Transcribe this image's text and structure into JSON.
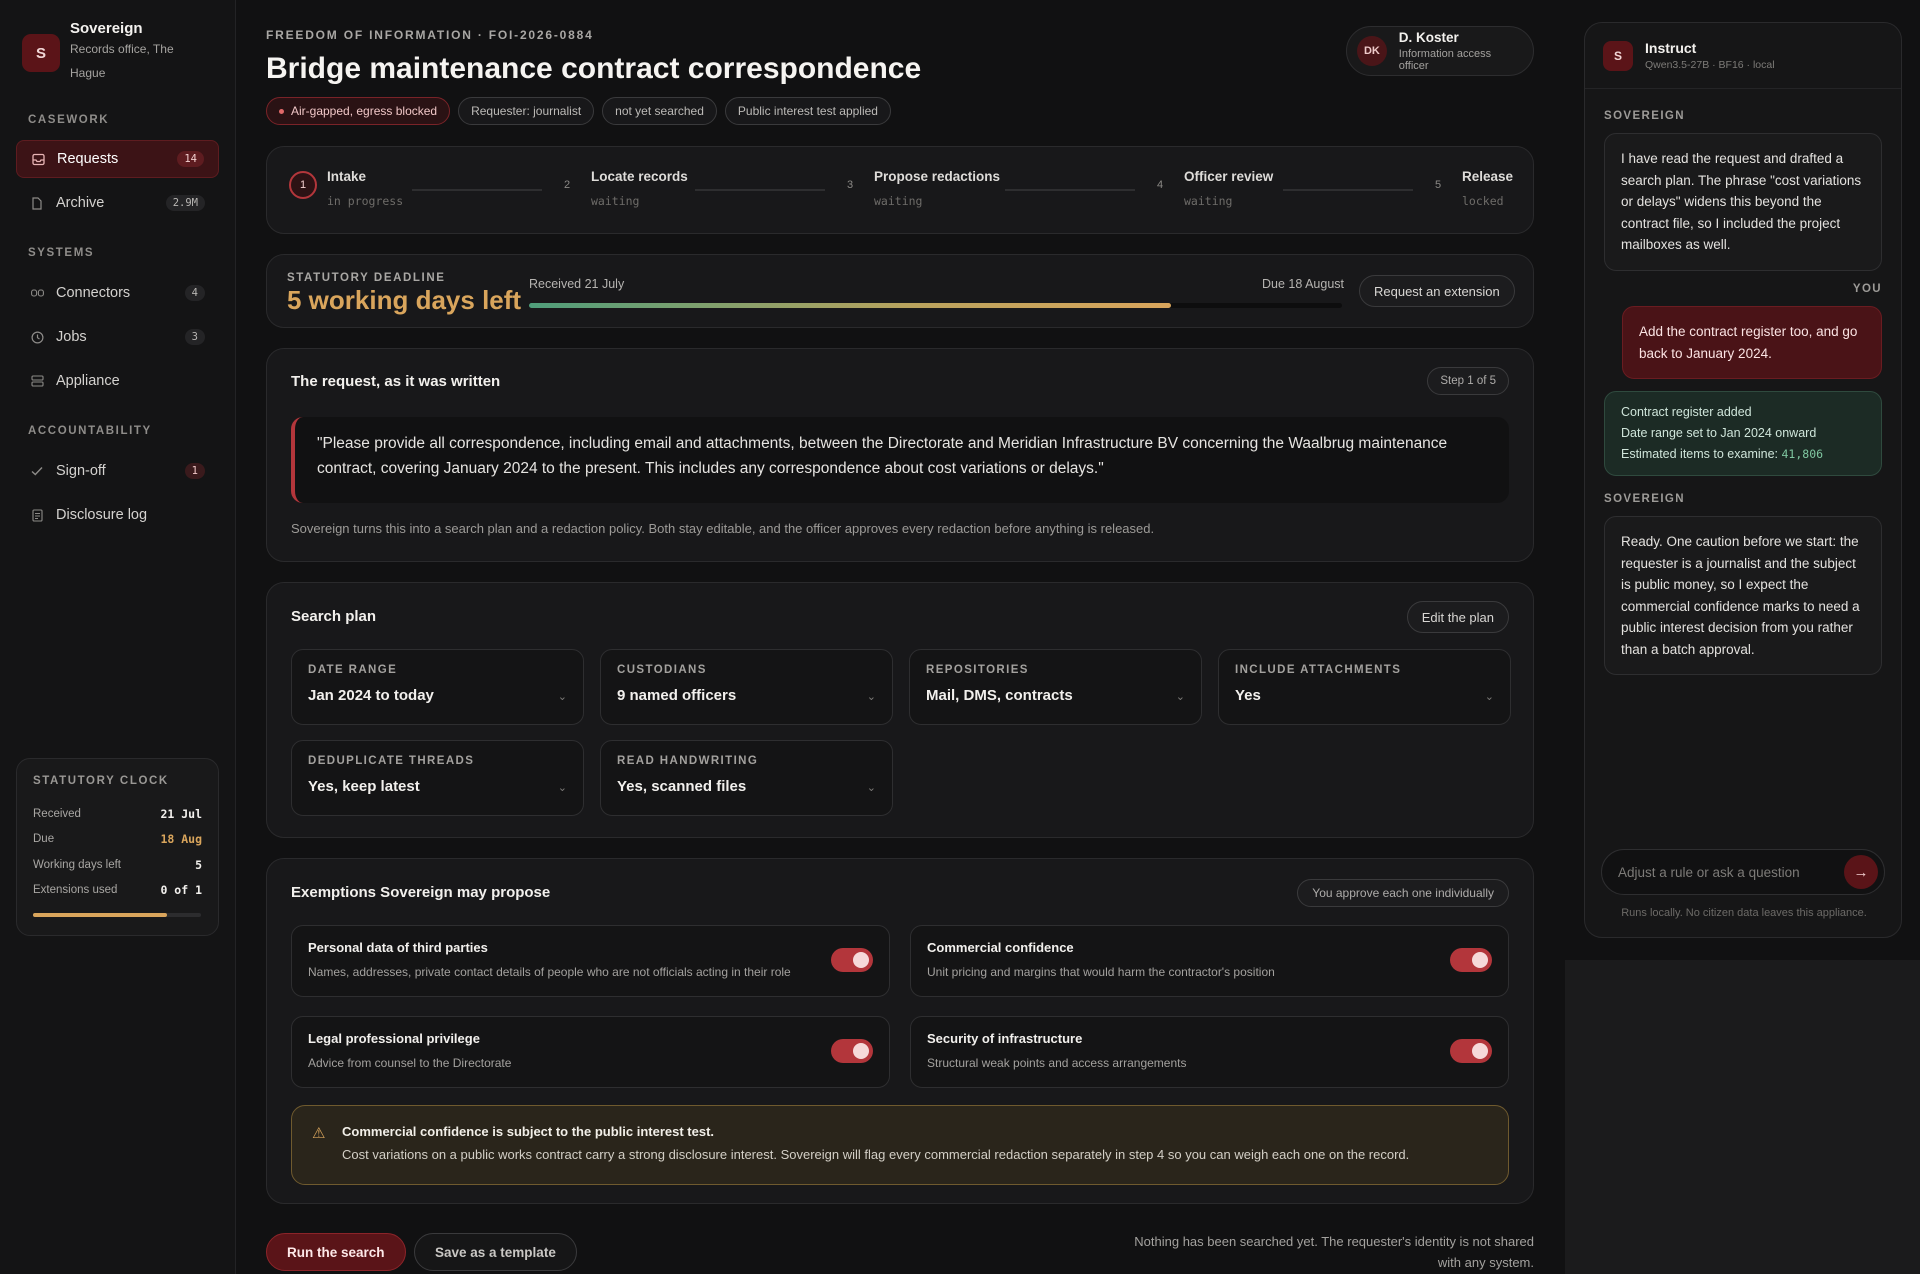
{
  "brand": {
    "name": "Sovereign",
    "subtitle": "Records office, The Hague",
    "initial": "S"
  },
  "nav": {
    "casework_label": "CASEWORK",
    "systems_label": "SYSTEMS",
    "accountability_label": "ACCOUNTABILITY",
    "items": [
      {
        "label": "Requests",
        "count": "14",
        "icon": "inbox-icon"
      },
      {
        "label": "Archive",
        "count": "2.9M",
        "icon": "file-icon"
      },
      {
        "label": "Connectors",
        "count": "4",
        "icon": "link-icon"
      },
      {
        "label": "Jobs",
        "count": "3",
        "icon": "clock-icon"
      },
      {
        "label": "Appliance",
        "count": "",
        "icon": "server-icon"
      },
      {
        "label": "Sign-off",
        "count": "1",
        "icon": "check-icon"
      },
      {
        "label": "Disclosure log",
        "count": "",
        "icon": "log-icon"
      }
    ]
  },
  "clock": {
    "title": "STATUTORY CLOCK",
    "rows": [
      {
        "label": "Received",
        "value": "21 Jul"
      },
      {
        "label": "Due",
        "value": "18 Aug"
      },
      {
        "label": "Working days left",
        "value": "5"
      },
      {
        "label": "Extensions used",
        "value": "0 of 1"
      }
    ],
    "progress": 0.8
  },
  "header": {
    "eyebrow": "FREEDOM OF INFORMATION · FOI-2026-0884",
    "title": "Bridge maintenance contract correspondence",
    "pills": [
      "Air-gapped, egress blocked",
      "Requester: journalist",
      "not yet searched",
      "Public interest test applied"
    ]
  },
  "user": {
    "initials": "DK",
    "name": "D. Koster",
    "role": "Information access officer"
  },
  "steps": [
    {
      "num": "1",
      "title": "Intake",
      "status": "in progress"
    },
    {
      "num": "2",
      "title": "Locate records",
      "status": "waiting"
    },
    {
      "num": "3",
      "title": "Propose redactions",
      "status": "waiting"
    },
    {
      "num": "4",
      "title": "Officer review",
      "status": "waiting"
    },
    {
      "num": "5",
      "title": "Release",
      "status": "locked"
    }
  ],
  "deadline": {
    "label": "STATUTORY DEADLINE",
    "big": "5 working days left",
    "received": "Received 21 July",
    "due": "Due 18 August",
    "progress": 0.79,
    "button": "Request an extension"
  },
  "request": {
    "title": "The request, as it was written",
    "step_badge": "Step 1 of 5",
    "quote": "\"Please provide all correspondence, including email and attachments, between the Directorate and Meridian Infrastructure BV concerning the Waalbrug maintenance contract, covering January 2024 to the present. This includes any correspondence about cost variations or delays.\"",
    "note": "Sovereign turns this into a search plan and a redaction policy. Both stay editable, and the officer approves every redaction before anything is released."
  },
  "plan": {
    "title": "Search plan",
    "edit": "Edit the plan",
    "fields": [
      {
        "label": "DATE RANGE",
        "value": "Jan 2024 to today"
      },
      {
        "label": "CUSTODIANS",
        "value": "9 named officers"
      },
      {
        "label": "REPOSITORIES",
        "value": "Mail, DMS, contracts"
      },
      {
        "label": "INCLUDE ATTACHMENTS",
        "value": "Yes"
      },
      {
        "label": "DEDUPLICATE THREADS",
        "value": "Yes, keep latest"
      },
      {
        "label": "READ HANDWRITING",
        "value": "Yes, scanned files"
      }
    ]
  },
  "exemptions": {
    "title": "Exemptions Sovereign may propose",
    "badge": "You approve each one individually",
    "items": [
      {
        "title": "Personal data of third parties",
        "desc": "Names, addresses, private contact details of people who are not officials acting in their role",
        "on": true
      },
      {
        "title": "Commercial confidence",
        "desc": "Unit pricing and margins that would harm the contractor's position",
        "on": true
      },
      {
        "title": "Legal professional privilege",
        "desc": "Advice from counsel to the Directorate",
        "on": true
      },
      {
        "title": "Security of infrastructure",
        "desc": "Structural weak points and access arrangements",
        "on": true
      }
    ],
    "warning_title": "Commercial confidence is subject to the public interest test.",
    "warning_text": "Cost variations on a public works contract carry a strong disclosure interest. Sovereign will flag every commercial redaction separately in step 4 so you can weigh each one on the record."
  },
  "actions": {
    "run": "Run the search",
    "template": "Save as a template",
    "footnote": "Nothing has been searched yet. The requester's identity is not shared with any system."
  },
  "chat": {
    "title": "Instruct",
    "model": "Qwen3.5-27B · BF16 · local",
    "initial": "S",
    "sovereign_label": "SOVEREIGN",
    "you_label": "YOU",
    "msg1": "I have read the request and drafted a search plan. The phrase \"cost variations or delays\" widens this beyond the contract file, so I included the project mailboxes as well.",
    "msg2": "Add the contract register too, and go back to January 2024.",
    "ok_line1": "Contract register added",
    "ok_line2": "Date range set to Jan 2024 onward",
    "ok_line3": "Estimated items to examine:",
    "ok_count": "41,806",
    "msg3": "Ready. One caution before we start: the requester is a journalist and the subject is public money, so I expect the commercial confidence marks to need a public interest decision from you rather than a batch approval.",
    "placeholder": "Adjust a rule or ask a question",
    "footer": "Runs locally. No citizen data leaves this appliance."
  },
  "colors": {
    "accent": "#b3363b",
    "amber": "#d9a55c",
    "success": "#4f9e7b"
  }
}
